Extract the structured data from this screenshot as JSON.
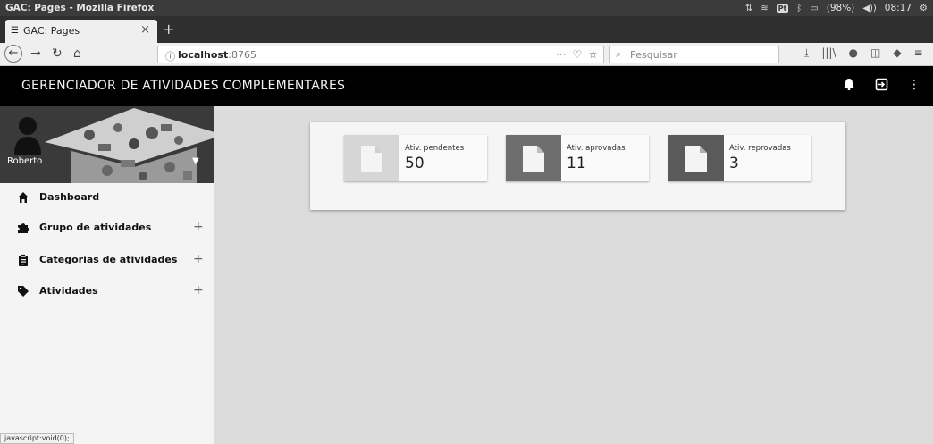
{
  "os": {
    "window_title": "GAC: Pages - Mozilla Firefox",
    "language_badge": "Pt",
    "battery_text": "(98%)",
    "clock": "08:17"
  },
  "browser": {
    "tab_title": "GAC: Pages",
    "url_host": "localhost",
    "url_port": ":8765",
    "search_placeholder": "Pesquisar",
    "status_url": "javascript:void(0);"
  },
  "app": {
    "title": "GERENCIADOR DE ATIVIDADES COMPLEMENTARES",
    "user_name": "Roberto"
  },
  "sidebar": {
    "items": [
      {
        "label": "Dashboard",
        "icon": "home-icon",
        "expandable": false
      },
      {
        "label": "Grupo de atividades",
        "icon": "puzzle-icon",
        "expandable": true,
        "expand_symbol": "+"
      },
      {
        "label": "Categorias de atividades",
        "icon": "clipboard-icon",
        "expandable": true,
        "expand_symbol": "+"
      },
      {
        "label": "Atividades",
        "icon": "tag-icon",
        "expandable": true,
        "expand_symbol": "+"
      }
    ]
  },
  "stats": [
    {
      "label": "Ativ. pendentes",
      "value": "50",
      "icon": "document-icon",
      "color": "#d6d6d6"
    },
    {
      "label": "Ativ. aprovadas",
      "value": "11",
      "icon": "document-icon",
      "color": "#6e6e6e"
    },
    {
      "label": "Ativ. reprovadas",
      "value": "3",
      "icon": "document-icon",
      "color": "#5a5a5a"
    }
  ]
}
